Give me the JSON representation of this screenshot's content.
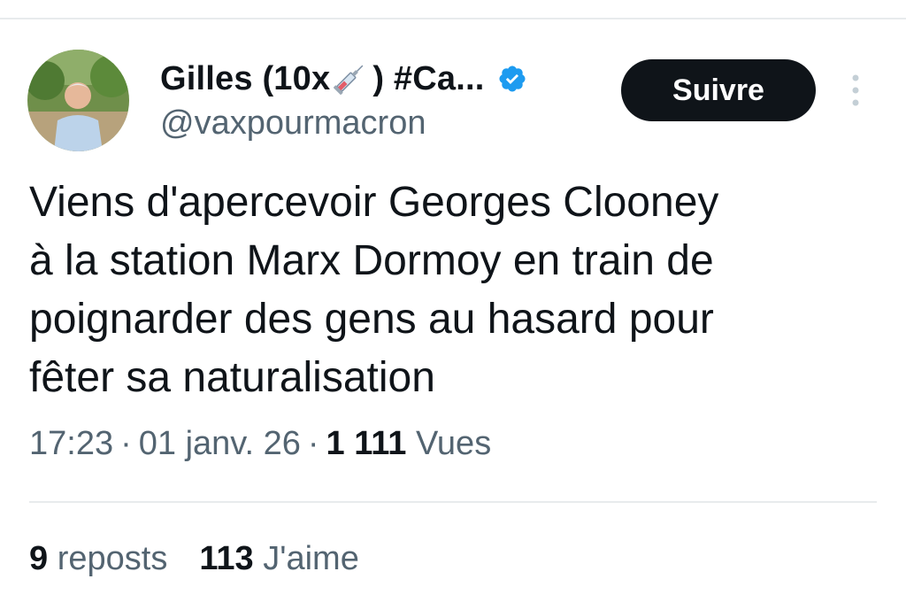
{
  "tweet": {
    "author": {
      "display_name_prefix": "Gilles (10x",
      "display_name_suffix": ") #Ca...",
      "handle": "@vaxpourmacron",
      "verified": true
    },
    "follow_label": "Suivre",
    "text": "Viens d'apercevoir Georges Clooney\nà la station Marx Dormoy en train de\npoignarder des gens au hasard pour\nfêter sa naturalisation",
    "time": "17:23",
    "date": "01 janv. 26",
    "separator": "·",
    "views_count": "1 111",
    "views_label": "Vues",
    "reposts_count": "9",
    "reposts_label": "reposts",
    "likes_count": "113",
    "likes_label": "J'aime"
  },
  "icons": {
    "syringe": "syringe-icon",
    "verified": "verified-badge-icon",
    "more": "more-vertical-icon"
  },
  "colors": {
    "primary_text": "#0f1419",
    "secondary_text": "#536471",
    "verified_blue": "#1d9bf0",
    "button_bg": "#0f1419",
    "divider": "#e8ebed"
  }
}
